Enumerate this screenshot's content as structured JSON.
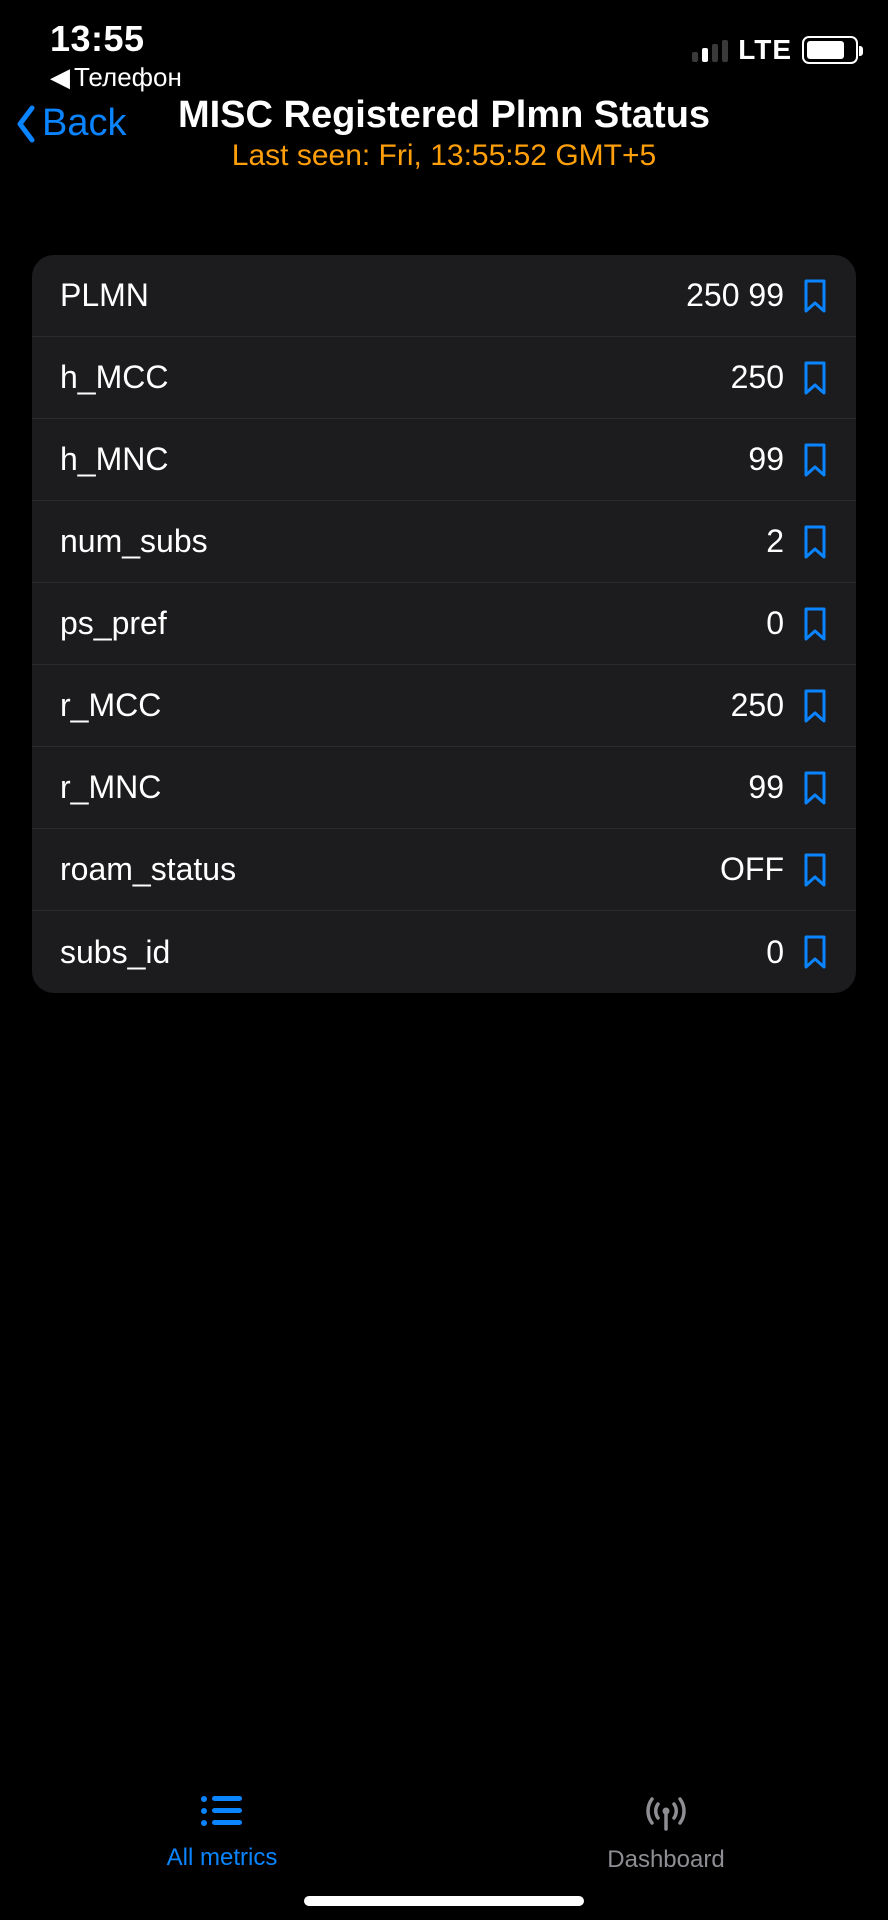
{
  "status": {
    "time": "13:55",
    "back_app": "Телефон",
    "network": "LTE"
  },
  "nav": {
    "back_label": "Back",
    "title": "MISC Registered Plmn Status",
    "subtitle": "Last seen: Fri, 13:55:52 GMT+5"
  },
  "rows": [
    {
      "label": "PLMN",
      "value": "250 99"
    },
    {
      "label": "h_MCC",
      "value": "250"
    },
    {
      "label": "h_MNC",
      "value": "99"
    },
    {
      "label": "num_subs",
      "value": "2"
    },
    {
      "label": "ps_pref",
      "value": "0"
    },
    {
      "label": "r_MCC",
      "value": "250"
    },
    {
      "label": "r_MNC",
      "value": "99"
    },
    {
      "label": "roam_status",
      "value": "OFF"
    },
    {
      "label": "subs_id",
      "value": "0"
    }
  ],
  "tabs": {
    "all_metrics": "All metrics",
    "dashboard": "Dashboard"
  },
  "colors": {
    "accent": "#0a84ff",
    "subtitle": "#ff9f0a",
    "card": "#1c1c1e",
    "inactive": "#8e8e93"
  }
}
